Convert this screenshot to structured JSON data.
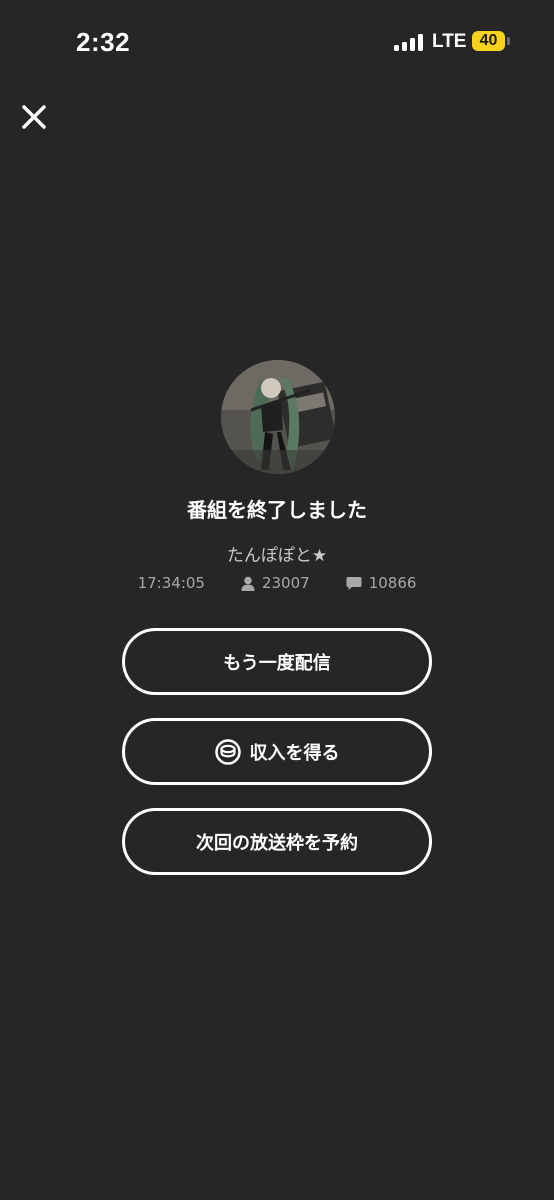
{
  "status_bar": {
    "time": "2:32",
    "network": "LTE",
    "battery": "40",
    "battery_color": "#f5d21c"
  },
  "header": {
    "close_icon": "close-icon"
  },
  "summary": {
    "title": "番組を終了しました",
    "username": "たんぽぽと★",
    "duration": "17:34:05",
    "viewers": "23007",
    "comments": "10866",
    "viewer_icon": "person-icon",
    "comment_icon": "comment-icon"
  },
  "actions": {
    "restream_label": "もう一度配信",
    "earn_label": "収入を得る",
    "earn_icon": "coin-stack-icon",
    "schedule_label": "次回の放送枠を予約"
  },
  "colors": {
    "background": "#262626",
    "text": "#ffffff",
    "muted": "#a8a8a8"
  }
}
